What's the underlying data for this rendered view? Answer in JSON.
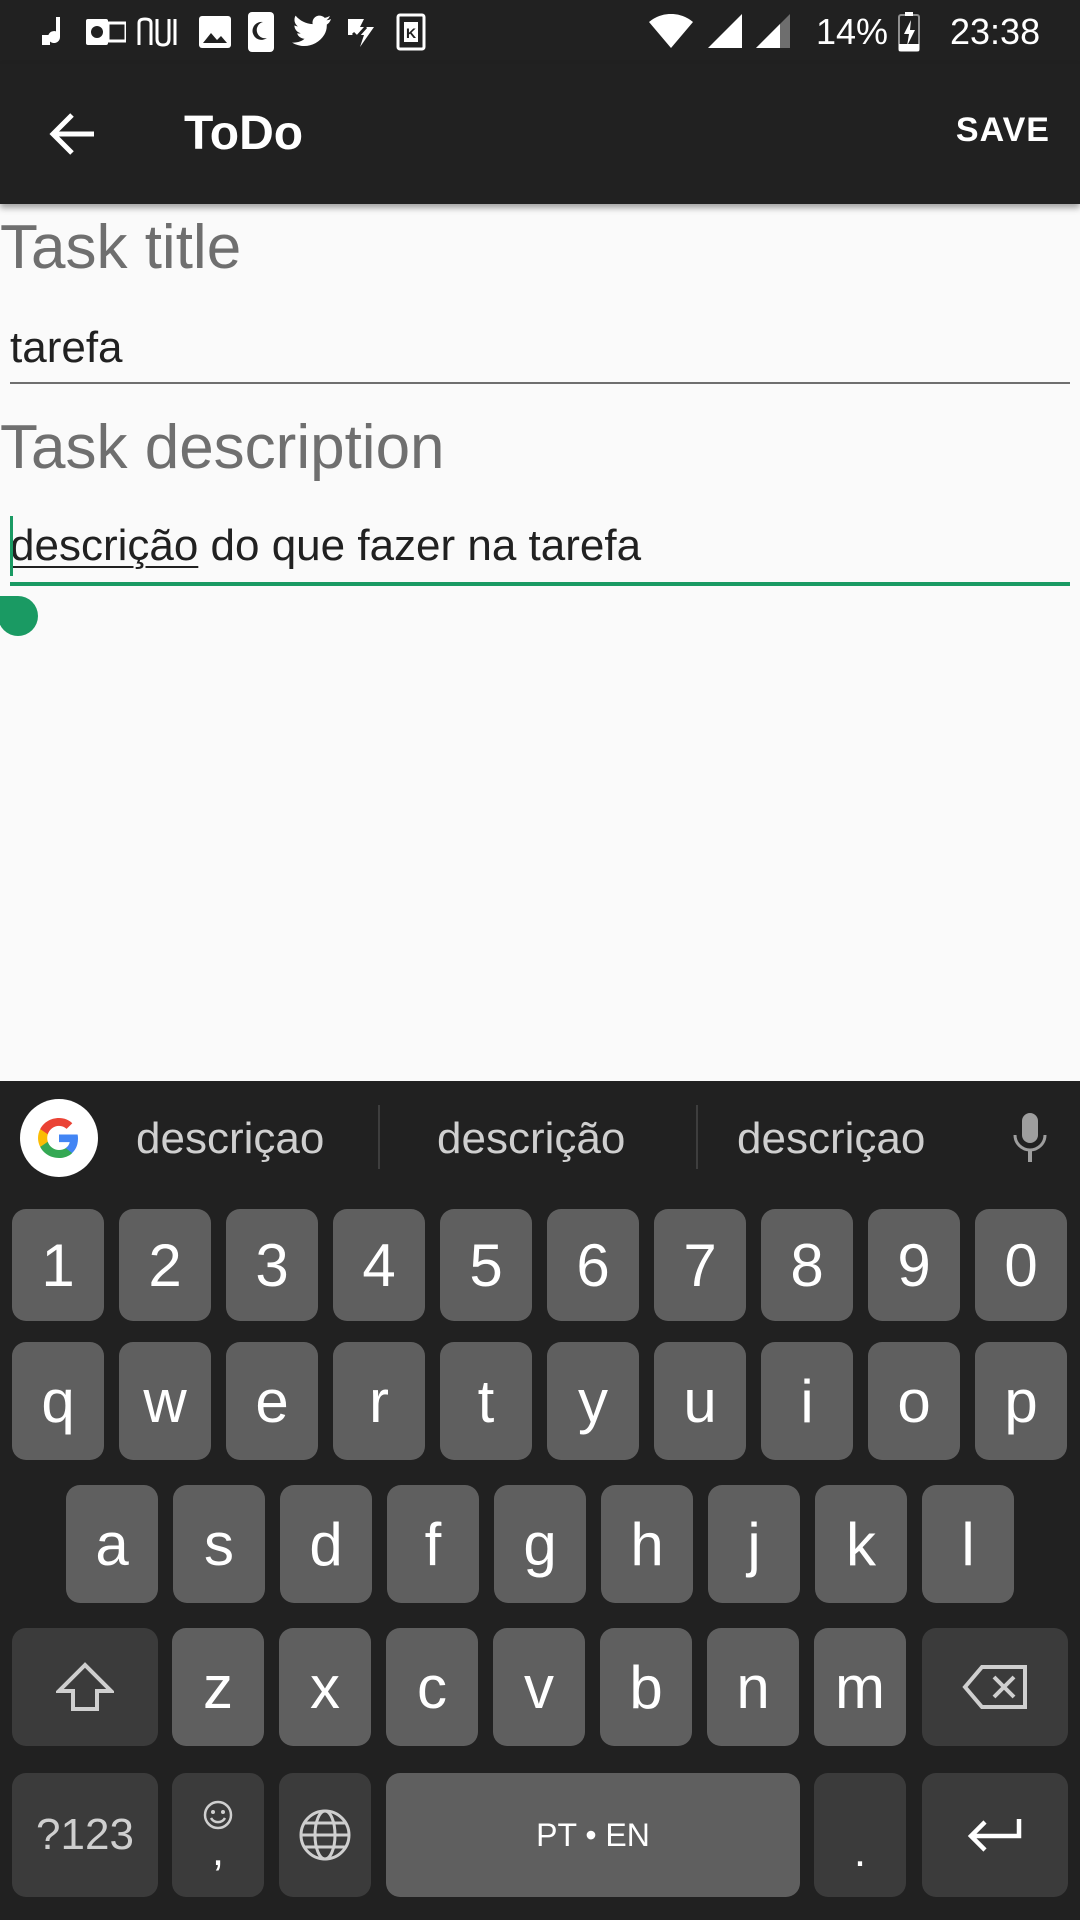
{
  "status_bar": {
    "battery": "14%",
    "time": "23:38",
    "icons": [
      "music-notification-icon",
      "outlook-icon",
      "nubank-icon",
      "gallery-icon",
      "phone-moon-icon",
      "twitter-icon",
      "check-app-icon",
      "k-app-icon",
      "wifi-icon",
      "signal-icon",
      "signal-icon-2",
      "battery-charging-icon"
    ]
  },
  "app_bar": {
    "title": "ToDo",
    "save_label": "SAVE",
    "back_icon": "arrow-back-icon"
  },
  "form": {
    "title_label": "Task title",
    "title_value": "tarefa",
    "description_label": "Task description",
    "description_typo": "descrição",
    "description_rest": " do que fazer na tarefa"
  },
  "keyboard": {
    "suggestions": [
      "descriçao",
      "descrição",
      "descriçao"
    ],
    "row_numbers": [
      "1",
      "2",
      "3",
      "4",
      "5",
      "6",
      "7",
      "8",
      "9",
      "0"
    ],
    "row_q": [
      "q",
      "w",
      "e",
      "r",
      "t",
      "y",
      "u",
      "i",
      "o",
      "p"
    ],
    "row_a": [
      "a",
      "s",
      "d",
      "f",
      "g",
      "h",
      "j",
      "k",
      "l"
    ],
    "row_z": [
      "z",
      "x",
      "c",
      "v",
      "b",
      "n",
      "m"
    ],
    "symbols_label": "?123",
    "space_label": "PT • EN",
    "period_label": ".",
    "emoji_comma_label": ",",
    "accent_color": "#1a9a63"
  }
}
